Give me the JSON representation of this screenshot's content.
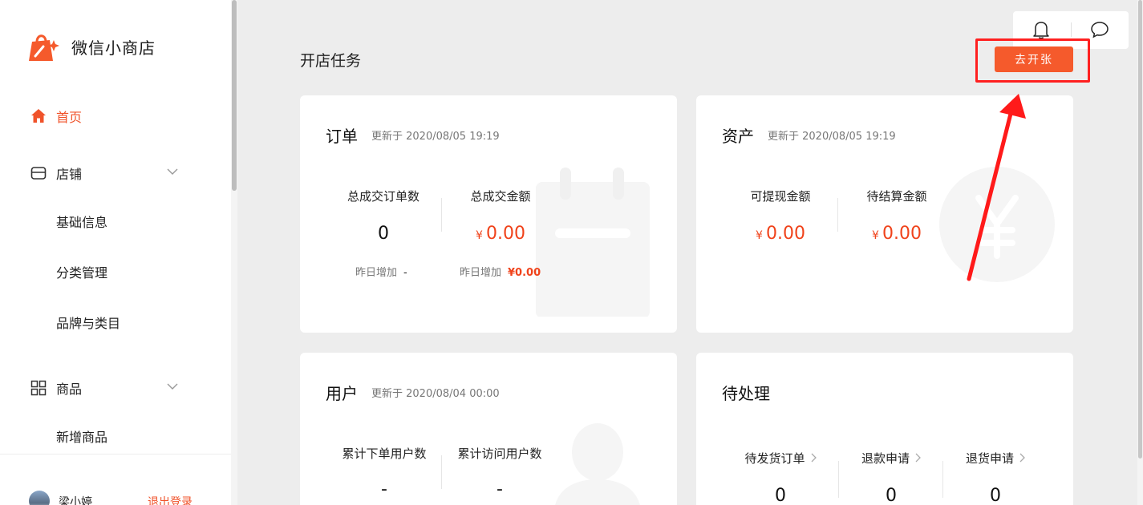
{
  "brand": {
    "name": "微信小商店"
  },
  "sidebar": {
    "items": [
      {
        "label": "首页",
        "icon": "home-icon"
      },
      {
        "label": "店铺",
        "icon": "store-icon"
      },
      {
        "label": "基础信息"
      },
      {
        "label": "分类管理"
      },
      {
        "label": "品牌与类目"
      },
      {
        "label": "商品",
        "icon": "grid-icon"
      },
      {
        "label": "新增商品"
      }
    ]
  },
  "user": {
    "name": "梁小婷",
    "logout_label": "退出登录"
  },
  "main": {
    "title": "开店任务",
    "open_button": "去开张"
  },
  "cards": {
    "orders": {
      "title": "订单",
      "updated": "更新于  2020/08/05 19:19",
      "stats": [
        {
          "label": "总成交订单数",
          "value": "0",
          "sub_label": "昨日增加",
          "sub_value": "-"
        },
        {
          "label": "总成交金额",
          "yen": "¥",
          "value": "0.00",
          "sub_label": "昨日增加",
          "sub_value": "¥0.00"
        }
      ]
    },
    "assets": {
      "title": "资产",
      "updated": "更新于  2020/08/05 19:19",
      "stats": [
        {
          "label": "可提现金额",
          "yen": "¥",
          "value": "0.00"
        },
        {
          "label": "待结算金额",
          "yen": "¥",
          "value": "0.00"
        }
      ]
    },
    "users": {
      "title": "用户",
      "updated": "更新于  2020/08/04 00:00",
      "stats": [
        {
          "label": "累计下单用户数",
          "value": "-"
        },
        {
          "label": "累计访问用户数",
          "value": "-"
        }
      ]
    },
    "pending": {
      "title": "待处理",
      "stats": [
        {
          "label": "待发货订单",
          "value": "0"
        },
        {
          "label": "退款申请",
          "value": "0"
        },
        {
          "label": "退货申请",
          "value": "0"
        }
      ]
    }
  },
  "colors": {
    "accent": "#f0532b",
    "annotation": "#ff2020"
  }
}
